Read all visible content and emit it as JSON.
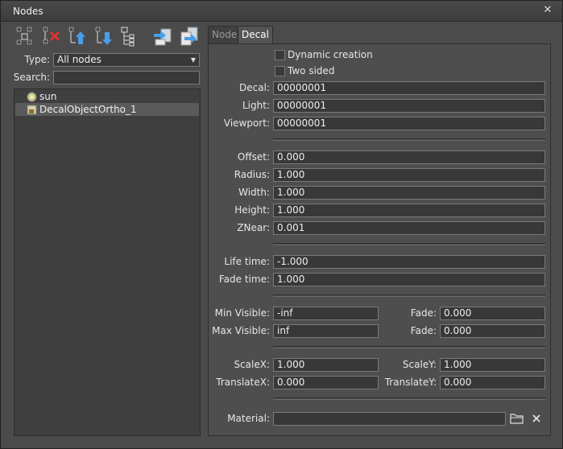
{
  "window": {
    "title": "Nodes",
    "close_glyph": "✕"
  },
  "toolbar": {
    "buttons": [
      {
        "icon": "node-group-icon"
      },
      {
        "icon": "node-delete-icon"
      },
      {
        "icon": "node-move-up-icon"
      },
      {
        "icon": "node-move-down-icon"
      },
      {
        "icon": "node-list-icon"
      },
      {
        "icon": "node-import-icon"
      },
      {
        "icon": "node-export-icon"
      }
    ]
  },
  "filter": {
    "type_label": "Type:",
    "type_value": "All nodes",
    "search_label": "Search:",
    "search_value": ""
  },
  "tree": {
    "items": [
      {
        "label": "sun",
        "icon": "world-light-icon",
        "selected": false
      },
      {
        "label": "DecalObjectOrtho_1",
        "icon": "decal-object-icon",
        "selected": true
      }
    ]
  },
  "tabs": [
    {
      "label": "Node",
      "active": false
    },
    {
      "label": "Decal",
      "active": true
    }
  ],
  "decal": {
    "dynamic_creation_label": "Dynamic creation",
    "dynamic_creation_checked": false,
    "two_sided_label": "Two sided",
    "two_sided_checked": false,
    "masks": [
      {
        "label": "Decal:",
        "value": "00000001"
      },
      {
        "label": "Light:",
        "value": "00000001"
      },
      {
        "label": "Viewport:",
        "value": "00000001"
      }
    ],
    "geometry": [
      {
        "label": "Offset:",
        "value": "0.000"
      },
      {
        "label": "Radius:",
        "value": "1.000"
      },
      {
        "label": "Width:",
        "value": "1.000"
      },
      {
        "label": "Height:",
        "value": "1.000"
      },
      {
        "label": "ZNear:",
        "value": "0.001"
      }
    ],
    "timing": [
      {
        "label": "Life time:",
        "value": "-1.000"
      },
      {
        "label": "Fade time:",
        "value": "1.000"
      }
    ],
    "visibility": {
      "min_label": "Min Visible:",
      "min_value": "-inf",
      "min_fade_label": "Fade:",
      "min_fade_value": "0.000",
      "max_label": "Max Visible:",
      "max_value": "inf",
      "max_fade_label": "Fade:",
      "max_fade_value": "0.000"
    },
    "transform": {
      "scalex_label": "ScaleX:",
      "scalex_value": "1.000",
      "scaley_label": "ScaleY:",
      "scaley_value": "1.000",
      "translatex_label": "TranslateX:",
      "translatex_value": "0.000",
      "translatey_label": "TranslateY:",
      "translatey_value": "0.000"
    },
    "material_label": "Material:",
    "material_value": ""
  }
}
